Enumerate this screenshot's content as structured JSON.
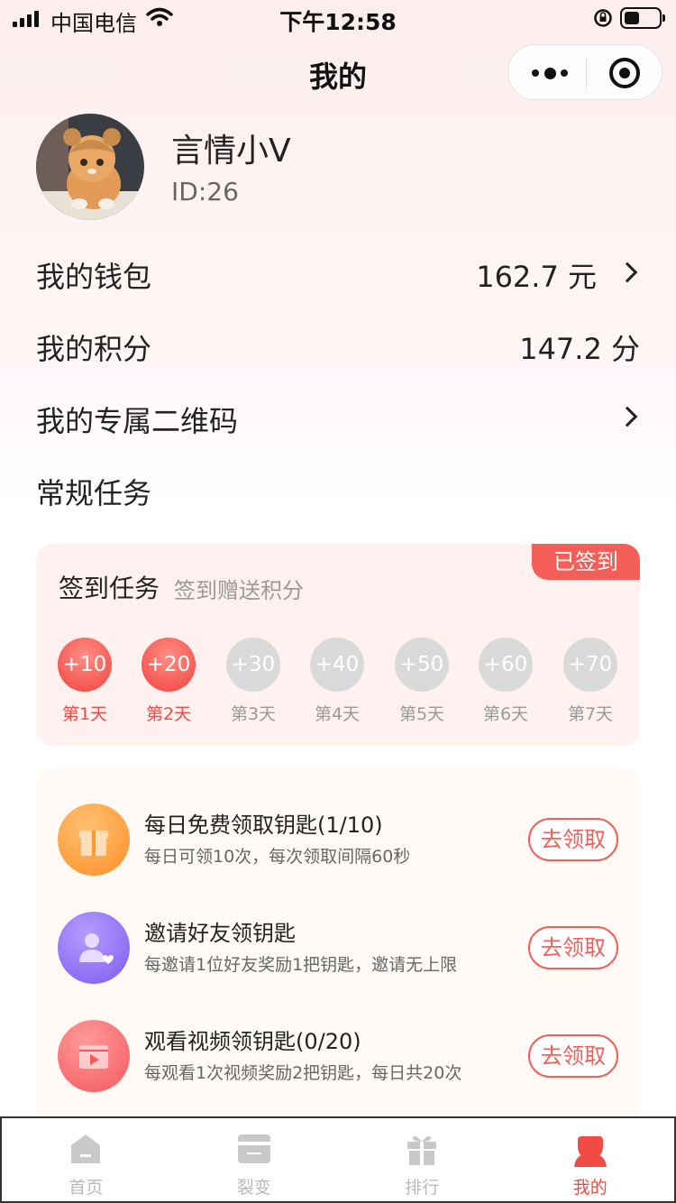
{
  "status_bar": {
    "carrier": "中国电信",
    "time": "下午12:58"
  },
  "nav": {
    "title": "我的",
    "more_icon": "more-dots-icon",
    "close_icon": "target-circle-icon"
  },
  "profile": {
    "name": "言情小V",
    "id": "ID:26"
  },
  "menu": {
    "wallet_label": "我的钱包",
    "wallet_value": "162.7 元",
    "points_label": "我的积分",
    "points_value": "147.2 分",
    "qrcode_label": "我的专属二维码",
    "section_title": "常规任务"
  },
  "sign": {
    "title": "签到任务",
    "subtitle": "签到赠送积分",
    "badge": "已签到",
    "days": [
      {
        "reward": "+10",
        "label": "第1天",
        "done": true
      },
      {
        "reward": "+20",
        "label": "第2天",
        "done": true
      },
      {
        "reward": "+30",
        "label": "第3天",
        "done": false
      },
      {
        "reward": "+40",
        "label": "第4天",
        "done": false
      },
      {
        "reward": "+50",
        "label": "第5天",
        "done": false
      },
      {
        "reward": "+60",
        "label": "第6天",
        "done": false
      },
      {
        "reward": "+70",
        "label": "第7天",
        "done": false
      }
    ]
  },
  "tasks": [
    {
      "title": "每日免费领取钥匙(1/10)",
      "desc": "每日可领10次，每次领取间隔60秒",
      "button": "去领取",
      "icon": "gift-icon",
      "color": "#ff9a2e"
    },
    {
      "title": "邀请好友领钥匙",
      "desc": "每邀请1位好友奖励1把钥匙，邀请无上限",
      "button": "去领取",
      "icon": "user-heart-icon",
      "color": "#8f6ef5"
    },
    {
      "title": "观看视频领钥匙(0/20)",
      "desc": "每观看1次视频奖励2把钥匙，每日共20次",
      "button": "去领取",
      "icon": "video-play-icon",
      "color": "#f5686a"
    }
  ],
  "tabbar": {
    "items": [
      {
        "label": "首页",
        "icon": "home-icon"
      },
      {
        "label": "裂变",
        "icon": "card-icon"
      },
      {
        "label": "排行",
        "icon": "gift-box-icon"
      },
      {
        "label": "我的",
        "icon": "profile-icon"
      }
    ],
    "active_index": 3,
    "active_color": "#f04b45"
  }
}
